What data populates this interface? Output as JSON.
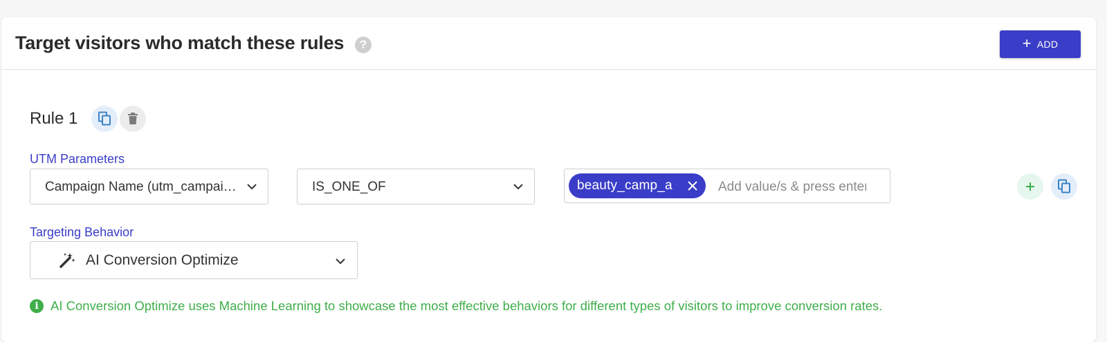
{
  "header": {
    "title": "Target visitors who match these rules",
    "help_icon": "?",
    "add_label": "ADD"
  },
  "rule": {
    "title": "Rule 1",
    "utm": {
      "label": "UTM Parameters",
      "parameter": "Campaign Name (utm_campaign)",
      "operator": "IS_ONE_OF",
      "values": [
        "beauty_camp_a"
      ],
      "placeholder": "Add value/s & press enter"
    },
    "targeting": {
      "label": "Targeting Behavior",
      "value": "AI Conversion Optimize",
      "icon": "magic-wand-icon"
    },
    "info": "AI Conversion Optimize uses Machine Learning to showcase the most effective behaviors for different types of visitors to improve conversion rates.",
    "info_icon": "i"
  },
  "colors": {
    "accent": "#3a3dc7",
    "success": "#3fae4a",
    "copy_bg": "#e4eefb",
    "add_rule_bg": "#e6f7ee"
  }
}
